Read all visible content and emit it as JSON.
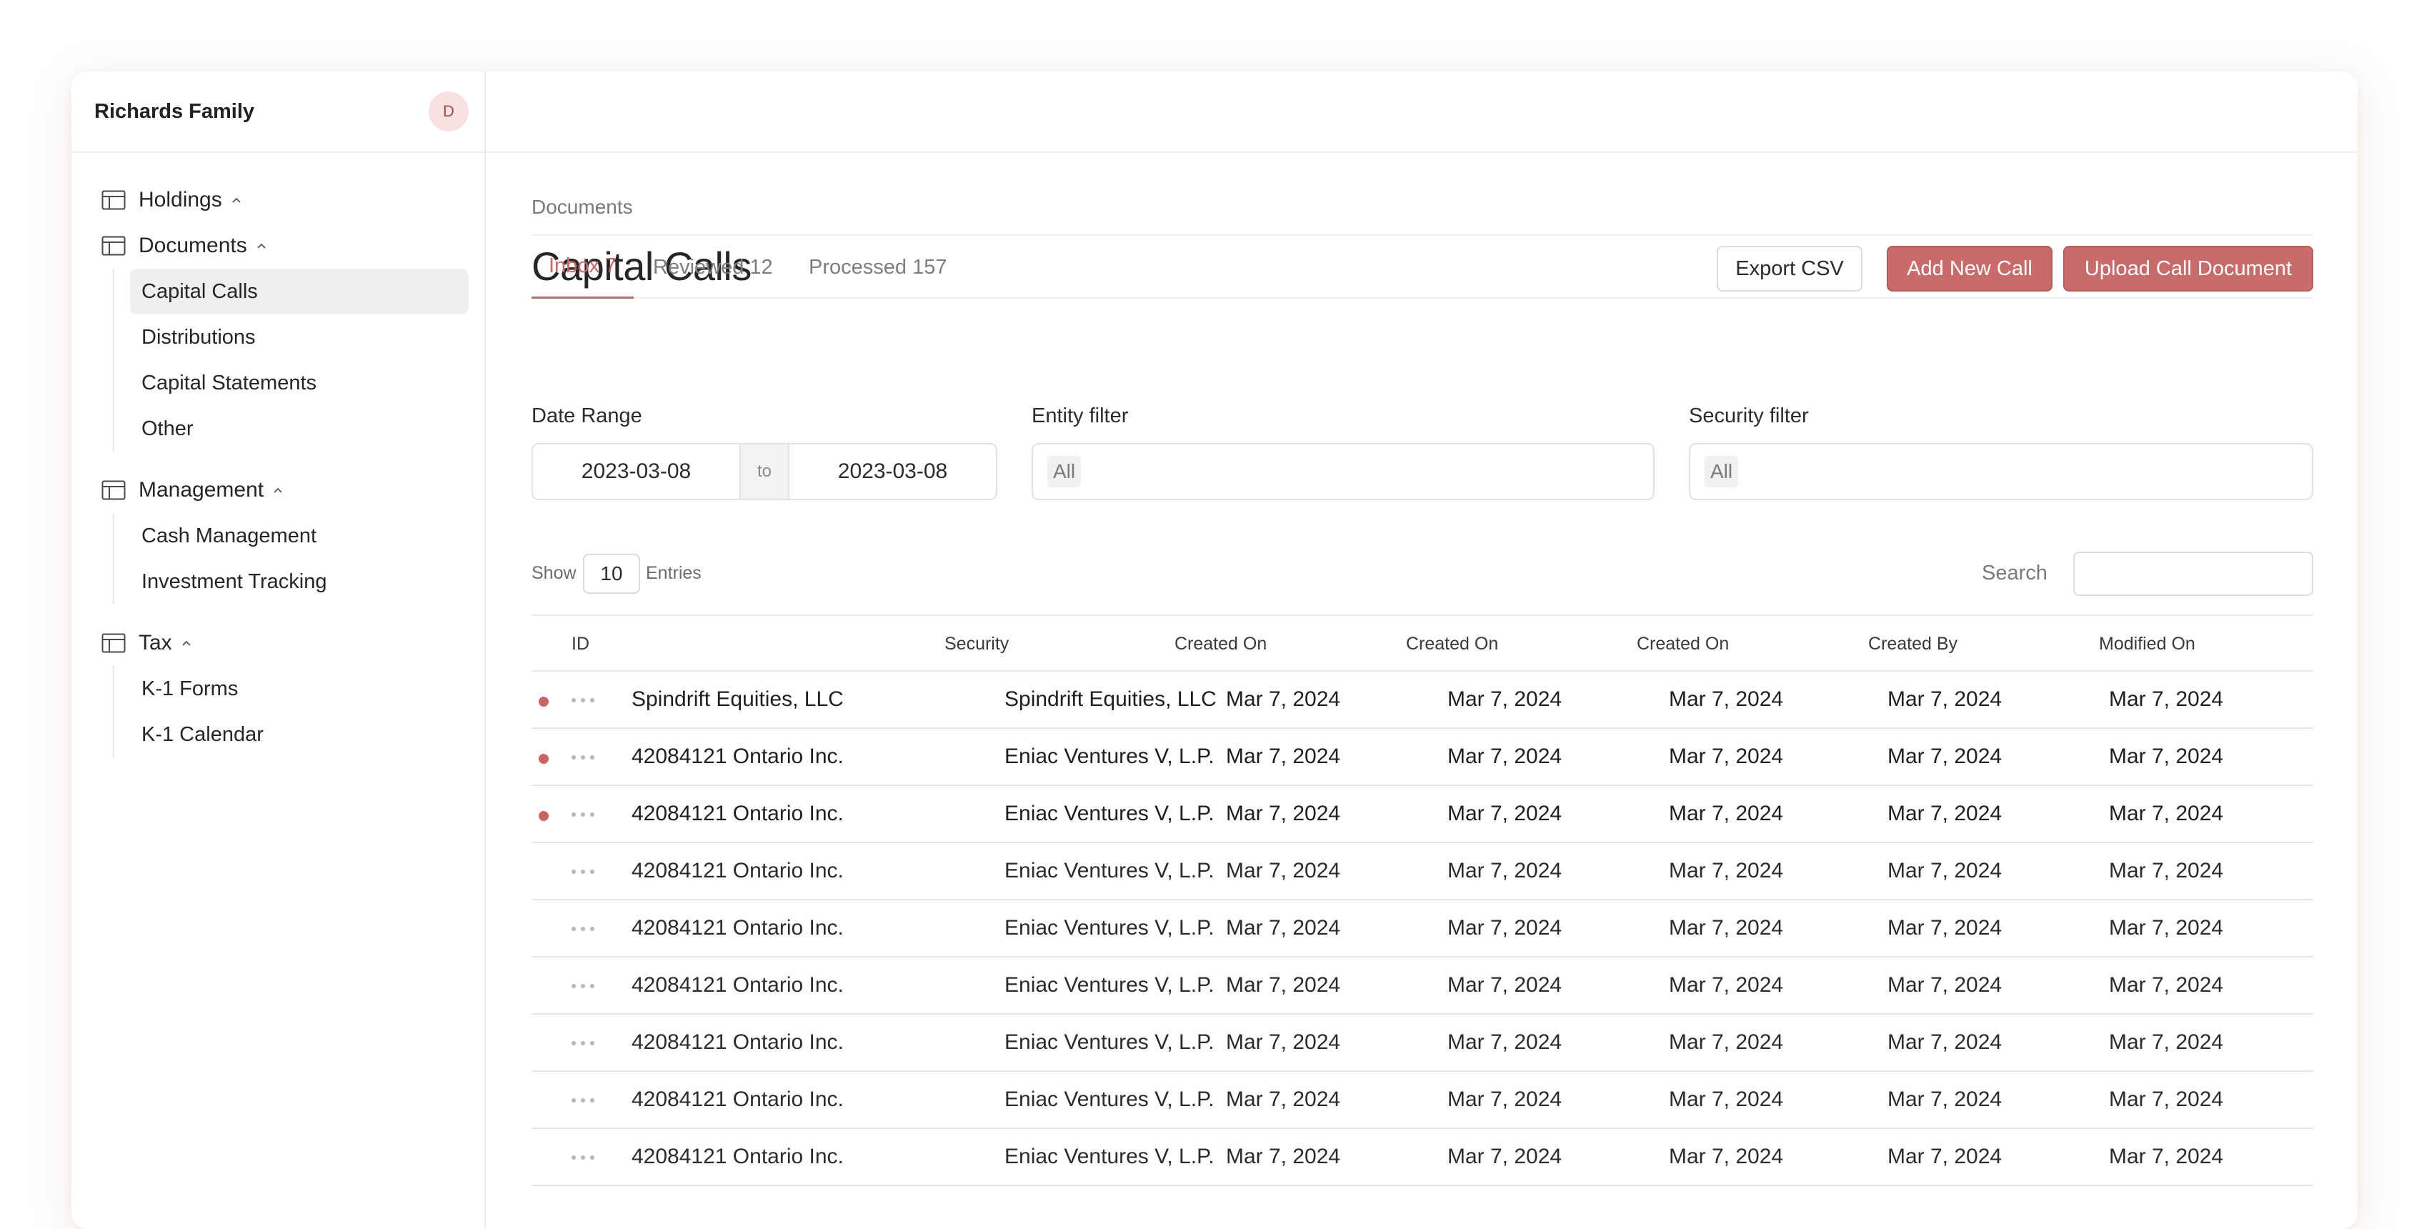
{
  "sidebar": {
    "family_name": "Richards Family",
    "avatar_initial": "D",
    "groups": [
      {
        "label": "Holdings",
        "icon": "table-icon",
        "items": []
      },
      {
        "label": "Documents",
        "icon": "table-icon",
        "items": [
          "Capital Calls",
          "Distributions",
          "Capital Statements",
          "Other"
        ]
      },
      {
        "label": "Management",
        "icon": "table-icon",
        "items": [
          "Cash Management",
          "Investment Tracking"
        ]
      },
      {
        "label": "Tax",
        "icon": "table-icon",
        "items": [
          "K-1 Forms",
          "K-1 Calendar"
        ]
      }
    ],
    "active_item": "Capital Calls"
  },
  "main": {
    "breadcrumb": "Documents",
    "title": "Capital Calls",
    "buttons": {
      "export": "Export CSV",
      "add": "Add New Call",
      "upload": "Upload Call Document"
    },
    "tabs": [
      "Inbox 7",
      "Reviewed 12",
      "Processed 157"
    ],
    "active_tab": "Inbox 7",
    "filters": {
      "date_range_label": "Date Range",
      "date_from": "2023-03-08",
      "date_sep": "to",
      "date_to": "2023-03-08",
      "entity_label": "Entity filter",
      "entity_value": "All",
      "security_label": "Security filter",
      "security_value": "All"
    },
    "entries": {
      "show_label": "Show",
      "count": "10",
      "entries_label": "Entries",
      "search_label": "Search"
    },
    "table": {
      "headers": [
        "ID",
        "Security",
        "Created On",
        "Created On",
        "Created On",
        "Created By",
        "Modified On"
      ],
      "rows": [
        {
          "unread": true,
          "cells": [
            "Spindrift Equities, LLC",
            "Spindrift Equities, LLC",
            "Mar 7, 2024",
            "Mar 7, 2024",
            "Mar 7, 2024",
            "Mar 7, 2024",
            "Mar 7, 2024"
          ]
        },
        {
          "unread": true,
          "cells": [
            "42084121 Ontario Inc.",
            "Eniac Ventures V, L.P.",
            "Mar 7, 2024",
            "Mar 7, 2024",
            "Mar 7, 2024",
            "Mar 7, 2024",
            "Mar 7, 2024"
          ]
        },
        {
          "unread": true,
          "cells": [
            "42084121 Ontario Inc.",
            "Eniac Ventures V, L.P.",
            "Mar 7, 2024",
            "Mar 7, 2024",
            "Mar 7, 2024",
            "Mar 7, 2024",
            "Mar 7, 2024"
          ]
        },
        {
          "unread": false,
          "cells": [
            "42084121 Ontario Inc.",
            "Eniac Ventures V, L.P.",
            "Mar 7, 2024",
            "Mar 7, 2024",
            "Mar 7, 2024",
            "Mar 7, 2024",
            "Mar 7, 2024"
          ]
        },
        {
          "unread": false,
          "cells": [
            "42084121 Ontario Inc.",
            "Eniac Ventures V, L.P.",
            "Mar 7, 2024",
            "Mar 7, 2024",
            "Mar 7, 2024",
            "Mar 7, 2024",
            "Mar 7, 2024"
          ]
        },
        {
          "unread": false,
          "cells": [
            "42084121 Ontario Inc.",
            "Eniac Ventures V, L.P.",
            "Mar 7, 2024",
            "Mar 7, 2024",
            "Mar 7, 2024",
            "Mar 7, 2024",
            "Mar 7, 2024"
          ]
        },
        {
          "unread": false,
          "cells": [
            "42084121 Ontario Inc.",
            "Eniac Ventures V, L.P.",
            "Mar 7, 2024",
            "Mar 7, 2024",
            "Mar 7, 2024",
            "Mar 7, 2024",
            "Mar 7, 2024"
          ]
        },
        {
          "unread": false,
          "cells": [
            "42084121 Ontario Inc.",
            "Eniac Ventures V, L.P.",
            "Mar 7, 2024",
            "Mar 7, 2024",
            "Mar 7, 2024",
            "Mar 7, 2024",
            "Mar 7, 2024"
          ]
        },
        {
          "unread": false,
          "cells": [
            "42084121 Ontario Inc.",
            "Eniac Ventures V, L.P.",
            "Mar 7, 2024",
            "Mar 7, 2024",
            "Mar 7, 2024",
            "Mar 7, 2024",
            "Mar 7, 2024"
          ]
        }
      ]
    }
  },
  "colors": {
    "accent": "#c96b6b",
    "unread_dot": "#c86464",
    "avatar_bg": "#f8e2e1"
  }
}
